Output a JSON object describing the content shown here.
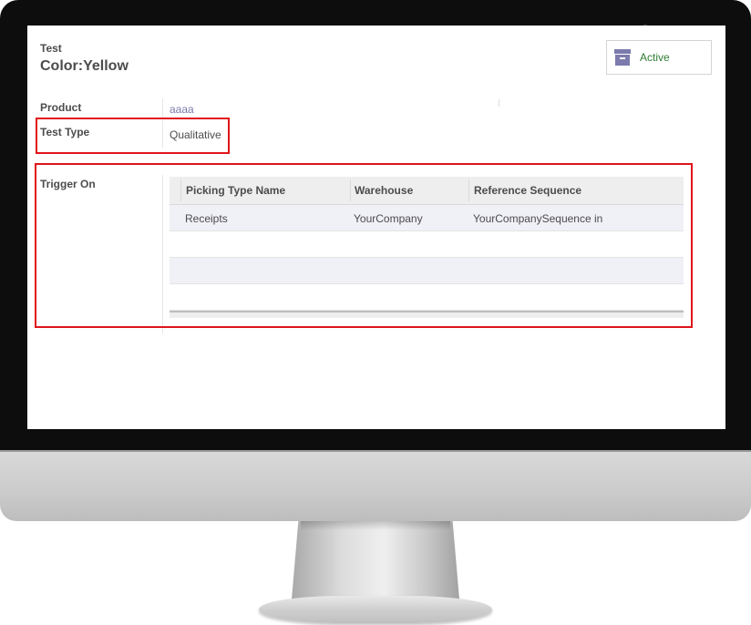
{
  "header": {
    "label": "Test",
    "title": "Color:Yellow"
  },
  "status_button": {
    "label": "Active",
    "icon": "archive-icon",
    "color": "#2e7d32"
  },
  "fields": {
    "product": {
      "label": "Product",
      "value": "aaaa"
    },
    "test_type": {
      "label": "Test Type",
      "value": "Qualitative"
    },
    "trigger_on": {
      "label": "Trigger On"
    }
  },
  "table": {
    "columns": [
      "Picking Type Name",
      "Warehouse",
      "Reference Sequence"
    ],
    "rows": [
      [
        "Receipts",
        "YourCompany",
        "YourCompanySequence in"
      ]
    ]
  },
  "colors": {
    "accent": "#7c7bad",
    "highlight_border": "#e0141b",
    "row_shade": "#f0f0f7"
  }
}
